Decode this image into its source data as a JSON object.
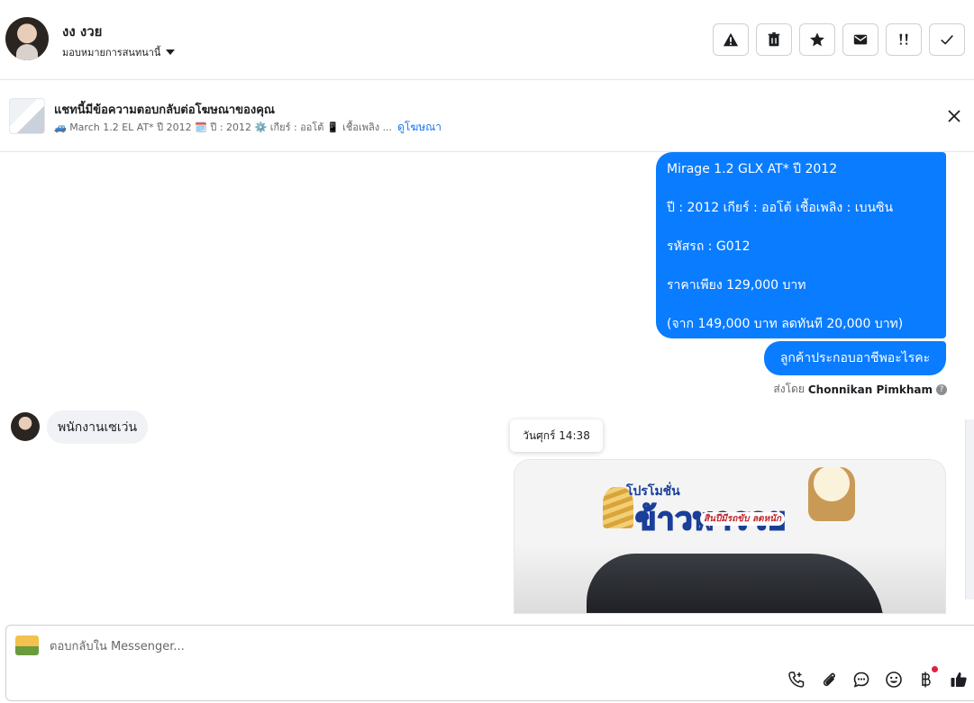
{
  "header": {
    "contact_name": "งง งวย",
    "assign_label": "มอบหมายการสนทนานี้",
    "actions": [
      "spam",
      "delete",
      "star",
      "mark-unread",
      "follow-up",
      "mark-done"
    ]
  },
  "ad_bar": {
    "title": "แชทนี้มีข้อความตอบกลับต่อโฆษณาของคุณ",
    "subtitle": "🚙 March 1.2 EL AT* ปี 2012 🗓️ ปี : 2012 ⚙️ เกียร์ : ออโต้ 📱 เชื้อเพลิง ...",
    "link": "ดูโฆษณา"
  },
  "conversation": {
    "outgoing_block": {
      "lines": [
        "Mirage 1.2 GLX AT* ปี 2012",
        " ปี : 2012     เกียร์ : ออโต้    เชื้อเพลิง : เบนซิน",
        " รหัสรถ : G012",
        " ราคาเพียง 129,000 บาท",
        "(จาก 149,000 บาท  ลดทันที 20,000 บาท)"
      ]
    },
    "outgoing_short": "ลูกค้าประกอบอาชีพอะไรคะ",
    "sent_by_prefix": "ส่งโดย",
    "sent_by_name": "Chonnikan Pimkham",
    "incoming_message": "พนักงานเซเว่น",
    "timestamp_tooltip": "วันศุกร์ 14:38",
    "promo_image": {
      "headline": "โปรโมชั่น",
      "title": "ข้าวพารวย",
      "tagline": "สินปีมีรถขับ ลดหนัก"
    }
  },
  "composer": {
    "placeholder": "ตอบกลับใน Messenger...",
    "tools": [
      "call-icon",
      "attach-icon",
      "saved-replies-icon",
      "emoji-icon",
      "payment-icon",
      "like-icon"
    ]
  },
  "colors": {
    "accent": "#0a7cff",
    "link": "#1877f2",
    "badge": "#e41e3f"
  }
}
